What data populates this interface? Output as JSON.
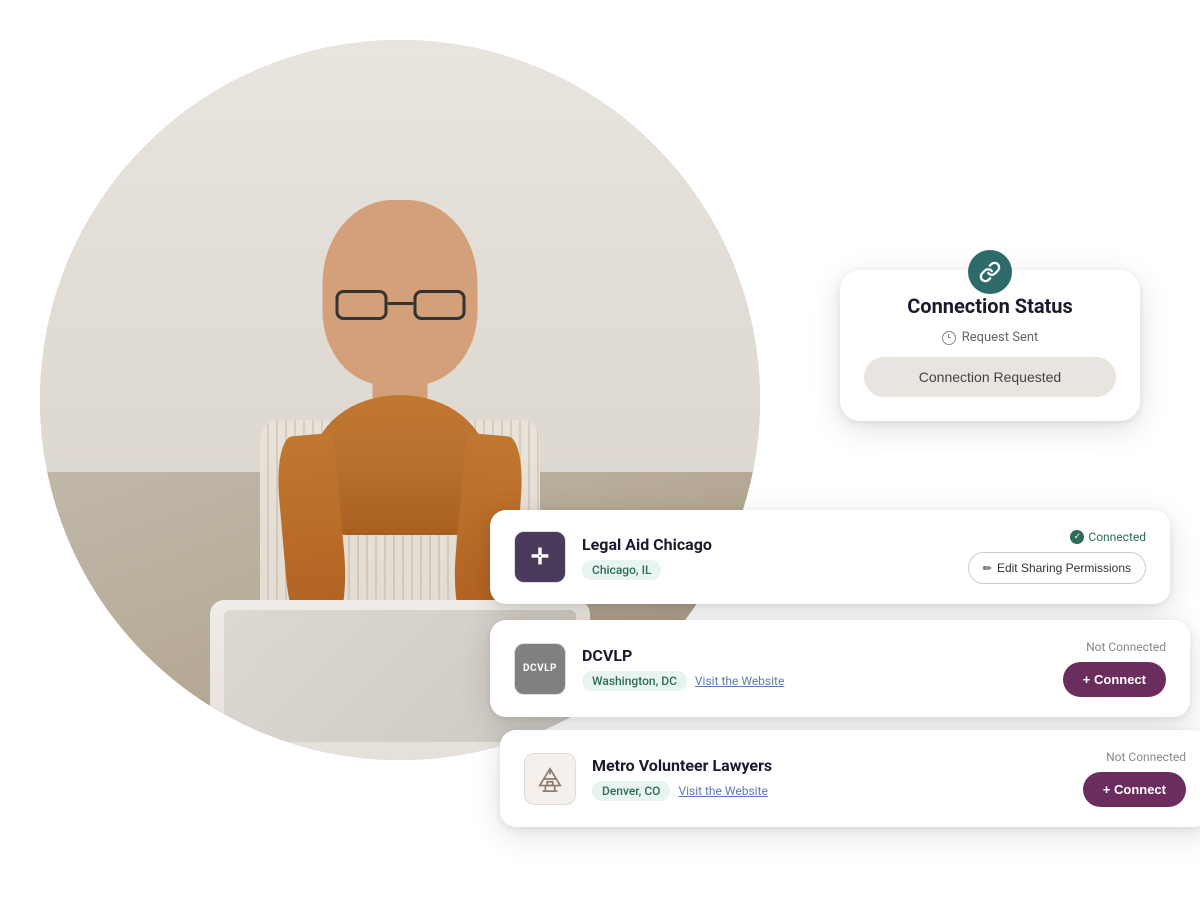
{
  "scene": {
    "background": "#ffffff"
  },
  "connectionStatusCard": {
    "title": "Connection Status",
    "requestSentLabel": "Request Sent",
    "connectionRequestedButton": "Connection Requested",
    "iconBadge": "link-icon"
  },
  "organizations": [
    {
      "id": "legal-aid-chicago",
      "name": "Legal Aid Chicago",
      "location": "Chicago, IL",
      "logo": "✛",
      "logoStyle": "legal-aid",
      "status": "Connected",
      "isConnected": true,
      "actionButton": "Edit Sharing Permissions",
      "actionButtonType": "edit"
    },
    {
      "id": "dcvlp",
      "name": "DCVLP",
      "location": "Washington, DC",
      "logo": "DCVLP",
      "logoStyle": "dcvlp",
      "status": "Not Connected",
      "isConnected": false,
      "actionButton": "+ Connect",
      "actionButtonType": "connect",
      "websiteLabel": "Visit the Website"
    },
    {
      "id": "metro-volunteer",
      "name": "Metro Volunteer Lawyers",
      "location": "Denver, CO",
      "logo": "🏛",
      "logoStyle": "metro",
      "status": "Not Connected",
      "isConnected": false,
      "actionButton": "+ Connect",
      "actionButtonType": "connect",
      "websiteLabel": "Visit the Website"
    }
  ]
}
